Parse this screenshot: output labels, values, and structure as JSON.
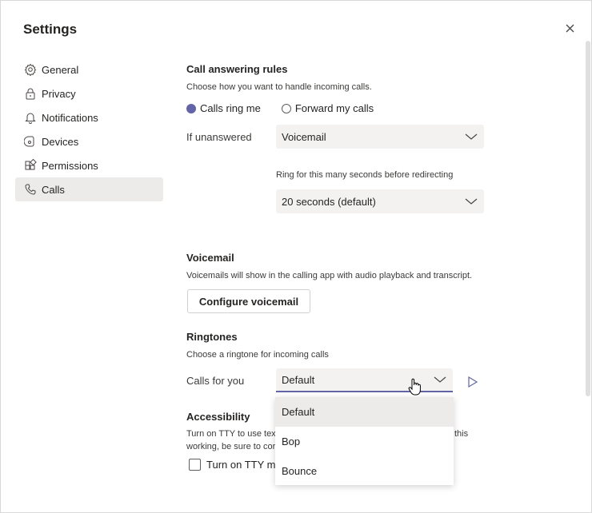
{
  "window": {
    "title": "Settings"
  },
  "sidebar": {
    "items": [
      {
        "label": "General",
        "icon": "gear-icon"
      },
      {
        "label": "Privacy",
        "icon": "lock-icon"
      },
      {
        "label": "Notifications",
        "icon": "bell-icon"
      },
      {
        "label": "Devices",
        "icon": "speaker-icon"
      },
      {
        "label": "Permissions",
        "icon": "apps-icon"
      },
      {
        "label": "Calls",
        "icon": "phone-icon",
        "active": true
      }
    ]
  },
  "call_answering": {
    "heading": "Call answering rules",
    "description": "Choose how you want to handle incoming calls.",
    "option_ring": "Calls ring me",
    "option_forward": "Forward my calls",
    "selected_option": "Calls ring me",
    "unanswered_label": "If unanswered",
    "unanswered_value": "Voicemail",
    "ring_label": "Ring for this many seconds before redirecting",
    "ring_value": "20 seconds (default)"
  },
  "voicemail": {
    "heading": "Voicemail",
    "description": "Voicemails will show in the calling app with audio playback and transcript.",
    "configure_button": "Configure voicemail"
  },
  "ringtones": {
    "heading": "Ringtones",
    "description": "Choose a ringtone for incoming calls",
    "calls_for_you_label": "Calls for you",
    "calls_for_you_value": "Default",
    "options": [
      "Default",
      "Bop",
      "Bounce"
    ]
  },
  "accessibility": {
    "heading": "Accessibility",
    "desc_line1_left": "Turn on TTY to use tex",
    "desc_line1_right": "this",
    "desc_line2_left": "working, be sure to cor",
    "checkbox_label": "Turn on TTY mo"
  },
  "colors": {
    "accent": "#6264a7",
    "active_nav_bg": "#edebe9",
    "select_bg": "#f3f2f1"
  }
}
